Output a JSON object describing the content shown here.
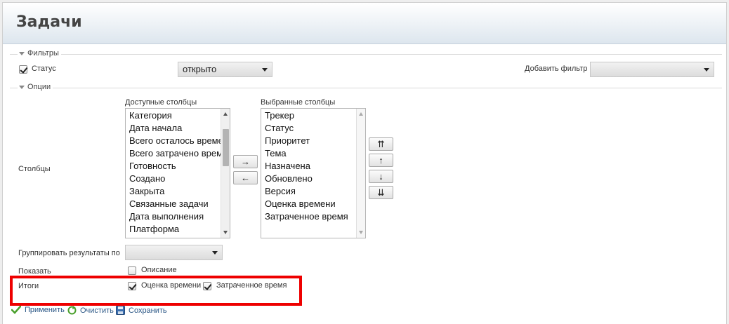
{
  "page": {
    "title": "Задачи"
  },
  "filters": {
    "legend": "Фильтры",
    "status_label": "Статус",
    "status_value": "открыто",
    "add_filter_label": "Добавить фильтр",
    "add_filter_value": ""
  },
  "options": {
    "legend": "Опции",
    "columns_label": "Столбцы",
    "available_label": "Доступные столбцы",
    "selected_label": "Выбранные столбцы",
    "available": [
      "Категория",
      "Дата начала",
      "Всего осталось времени",
      "Всего затрачено времени",
      "Готовность",
      "Создано",
      "Закрыта",
      "Связанные задачи",
      "Дата выполнения",
      "Платформа"
    ],
    "selected": [
      "Трекер",
      "Статус",
      "Приоритет",
      "Тема",
      "Назначена",
      "Обновлено",
      "Версия",
      "Оценка времени",
      "Затраченное время"
    ],
    "move_right": "→",
    "move_left": "←",
    "move_top": "⇈",
    "move_up": "↑",
    "move_down": "↓",
    "move_bottom": "⇊",
    "group_by_label": "Группировать результаты по",
    "group_by_value": "",
    "show_label": "Показать",
    "show_description": "Описание",
    "totals_label": "Итоги",
    "total_estimated": "Оценка времени",
    "total_spent": "Затраченное время"
  },
  "actions": {
    "apply": "Применить",
    "clear": "Очистить",
    "save": "Сохранить"
  },
  "colors": {
    "link": "#2a5685",
    "highlight": "#ee0000",
    "header_bottom": "#dde6ee"
  }
}
